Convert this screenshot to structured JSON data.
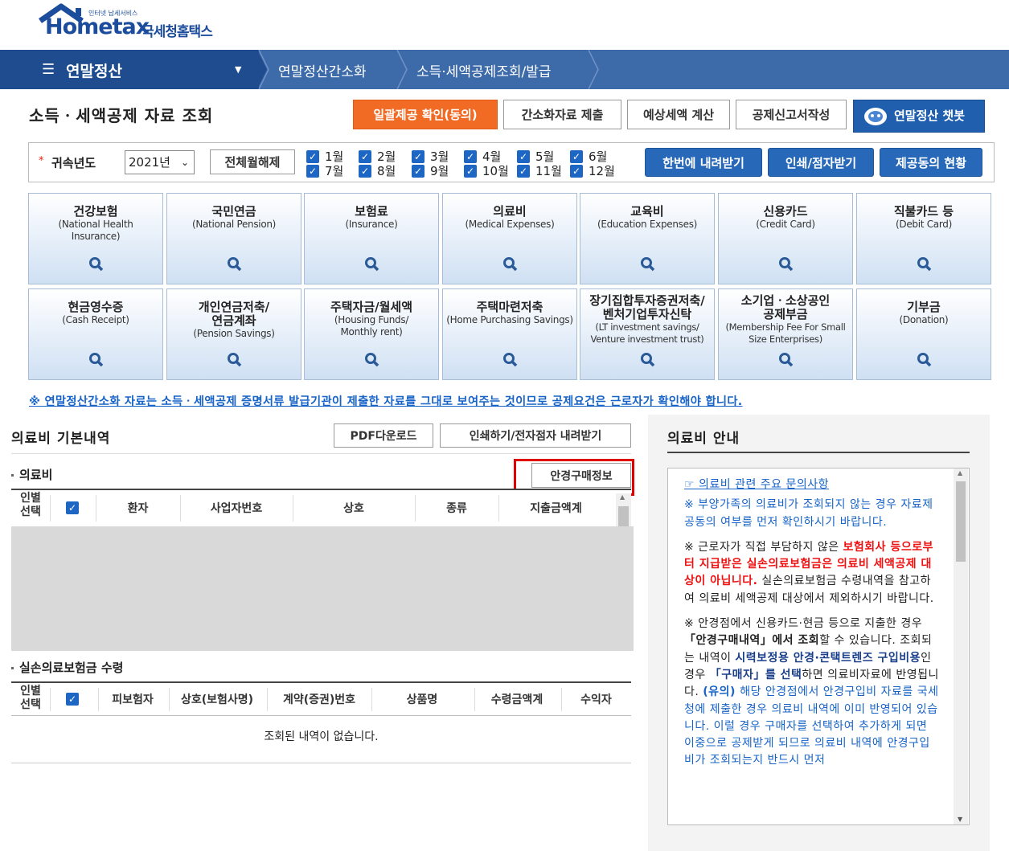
{
  "logo": {
    "brand": "Hometax",
    "small": "인터넷 납세서비스",
    "kr": "국세청홈택스"
  },
  "nav": {
    "menu_title": "연말정산",
    "crumb1": "연말정산간소화",
    "crumb2": "소득·세액공제조회/발급"
  },
  "page_title": "소득ㆍ세액공제 자료 조회",
  "buttons": {
    "bulk_confirm": "일괄제공 확인(동의)",
    "submit_simplified": "간소화자료 제출",
    "estimate_tax": "예상세액 계산",
    "deduction_form": "공제신고서작성",
    "chatbot": "연말정산 챗봇",
    "download_all": "한번에 내려받기",
    "print_braille": "인쇄/점자받기",
    "consent_status": "제공동의 현황",
    "deselect_months": "전체월해제",
    "pdf_download": "PDF다운로드",
    "print_download": "인쇄하기/전자점자 내려받기",
    "glasses_info": "안경구매정보"
  },
  "filter": {
    "label": "귀속년도",
    "year": "2021년",
    "months_row1": [
      "1월",
      "2월",
      "3월",
      "4월",
      "5월",
      "6월"
    ],
    "months_row2": [
      "7월",
      "8월",
      "9월",
      "10월",
      "11월",
      "12월"
    ]
  },
  "tiles": [
    {
      "kr": "건강보험",
      "en": "(National Health Insurance)"
    },
    {
      "kr": "국민연금",
      "en": "(National Pension)"
    },
    {
      "kr": "보험료",
      "en": "(Insurance)"
    },
    {
      "kr": "의료비",
      "en": "(Medical Expenses)"
    },
    {
      "kr": "교육비",
      "en": "(Education Expenses)"
    },
    {
      "kr": "신용카드",
      "en": "(Credit Card)"
    },
    {
      "kr": "직불카드 등",
      "en": "(Debit Card)"
    },
    {
      "kr": "현금영수증",
      "en": "(Cash Receipt)"
    },
    {
      "kr": "개인연금저축/ 연금계좌",
      "en": "(Pension Savings)"
    },
    {
      "kr": "주택자금/월세액",
      "en": "(Housing Funds/ Monthly rent)"
    },
    {
      "kr": "주택마련저축",
      "en": "(Home Purchasing Savings)"
    },
    {
      "kr": "장기집합투자증권저축/ 벤처기업투자신탁",
      "en": "(LT investment savings/ Venture investment trust)"
    },
    {
      "kr": "소기업ㆍ소상공인 공제부금",
      "en": "(Membership Fee For Small Size Enterprises)"
    },
    {
      "kr": "기부금",
      "en": "(Donation)"
    }
  ],
  "notice": "※ 연말정산간소화 자료는 소득ㆍ세액공제 증명서류 발급기관이 제출한 자료를 그대로 보여주는 것이므로 공제요건은 근로자가 확인해야 합니다.",
  "medical": {
    "section_title": "의료비 기본내역",
    "sub_title": "의료비",
    "columns": [
      "인별 선택",
      "환자",
      "사업자번호",
      "상호",
      "종류",
      "지출금액계"
    ]
  },
  "insurance": {
    "sub_title": "실손의료보험금 수령",
    "columns": [
      "인별 선택",
      "피보험자",
      "상호(보험사명)",
      "계약(증권)번호",
      "상품명",
      "수령금액계",
      "수익자"
    ],
    "empty": "조회된 내역이 없습니다."
  },
  "guide": {
    "title": "의료비 안내",
    "link": "☞ 의료비 관련 주요 문의사항",
    "p1": "※ 부양가족의 의료비가 조회되지 않는 경우 자료제공동의 여부를 먼저 확인하시기 바랍니다.",
    "p2a": "※ 근로자가 직접 부담하지 않은 ",
    "p2b": "보험회사 등으로부터 지급받은 실손의료보험금은 의료비 세액공제 대상이 아닙니다.",
    "p2c": " 실손의료보험금 수령내역을 참고하여 의료비 세액공제 대상에서 제외하시기 바랍니다.",
    "p3a": "※ 안경점에서 신용카드·현금 등으로 지출한 경우 ",
    "p3b": "「안경구매내역」에서 조회",
    "p3c": "할 수 있습니다. 조회되는 내역이 ",
    "p3d": "시력보정용 안경·콘택트렌즈 구입비용",
    "p3e": "인 경우 ",
    "p3f": "「구매자」를 선택",
    "p3g": "하면 의료비자료에 반영됩니다. ",
    "p3h": "(유의) ",
    "p3i": "해당 안경점에서 안경구입비 자료를 국세청에 제출한 경우 의료비 내역에 이미 반영되어 있습니다. 이럴 경우 구매자를 선택하여 추가하게 되면 이중으로 공제받게 되므로 의료비 내역에 안경구입비가 조회되는지 반드시 먼저"
  },
  "colors": {
    "nav": "#3d6aa9",
    "nav_dark": "#1e4c8f",
    "orange": "#f26b24",
    "highlight": "#e00000",
    "link": "#1763c7"
  }
}
